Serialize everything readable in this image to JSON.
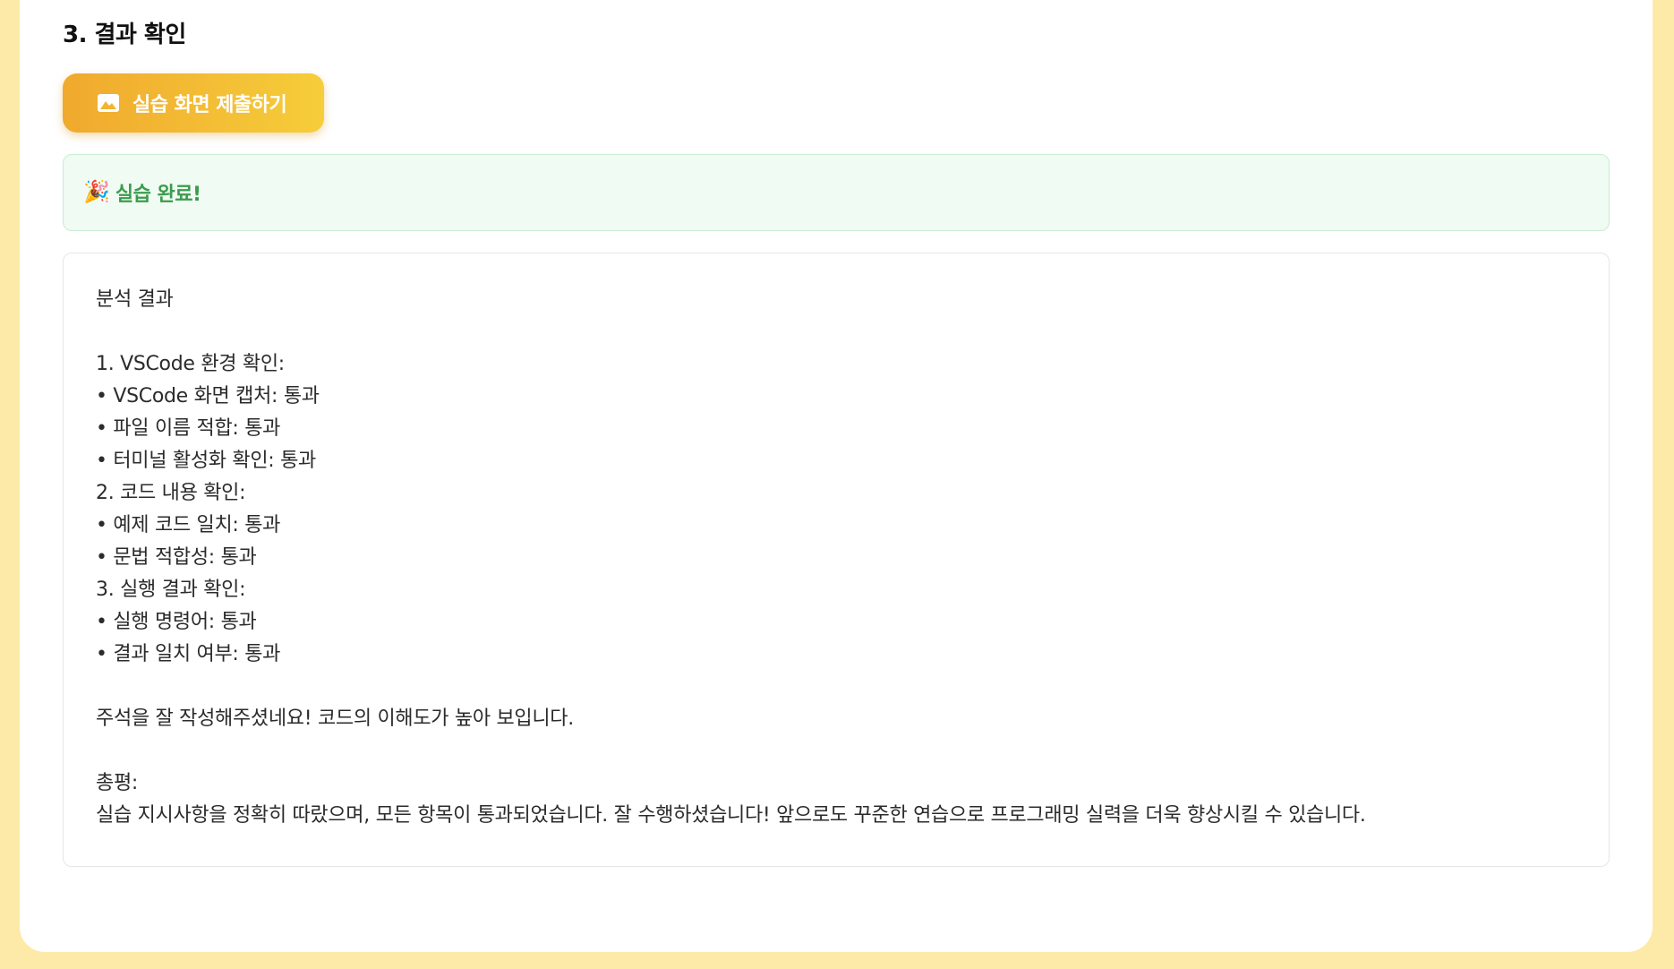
{
  "section": {
    "title": "3. 결과 확인"
  },
  "submit_button": {
    "icon": "image-icon",
    "label": "실습 화면 제출하기"
  },
  "status": {
    "icon": "🎉",
    "message": "실습 완료!",
    "color": "#3b9b4d"
  },
  "analysis": {
    "heading": "분석 결과",
    "sections": [
      {
        "title": "1. VSCode 환경 확인:",
        "items": [
          "• VSCode 화면 캡처: 통과",
          "• 파일 이름 적합: 통과",
          "• 터미널 활성화 확인: 통과"
        ]
      },
      {
        "title": "2. 코드 내용 확인:",
        "items": [
          "• 예제 코드 일치: 통과",
          "• 문법 적합성: 통과"
        ]
      },
      {
        "title": "3. 실행 결과 확인:",
        "items": [
          "• 실행 명령어: 통과",
          "• 결과 일치 여부: 통과"
        ]
      }
    ],
    "comment": "주석을 잘 작성해주셨네요! 코드의 이해도가 높아 보입니다.",
    "summary_label": "총평:",
    "summary_text": "실습 지시사항을 정확히 따랐으며, 모든 항목이 통과되었습니다. 잘 수행하셨습니다! 앞으로도 꾸준한 연습으로 프로그래밍 실력을 더욱 향상시킬 수 있습니다."
  }
}
